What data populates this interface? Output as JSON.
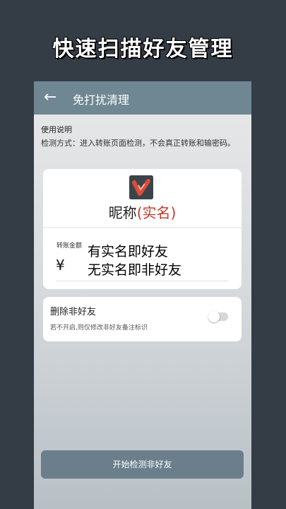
{
  "promo_title": "快速扫描好友管理",
  "app": {
    "back_icon": "arrow-left-icon",
    "title": "免打扰清理"
  },
  "usage": {
    "title": "使用说明",
    "description": "检测方式：进入转账页面检测，不会真正转账和输密码。"
  },
  "transfer_card": {
    "logo_icon": "app-logo-icon",
    "nickname": "昵称",
    "realname": "(实名)",
    "amount_label": "转账金额",
    "currency_symbol": "¥",
    "overlay_line1": "有实名即好友",
    "overlay_line2": "无实名即非好友"
  },
  "delete_option": {
    "label": "删除非好友",
    "hint": "若不开启,则仅修改非好友备注标识",
    "enabled": false
  },
  "start_button": {
    "label": "开始检测非好友"
  }
}
